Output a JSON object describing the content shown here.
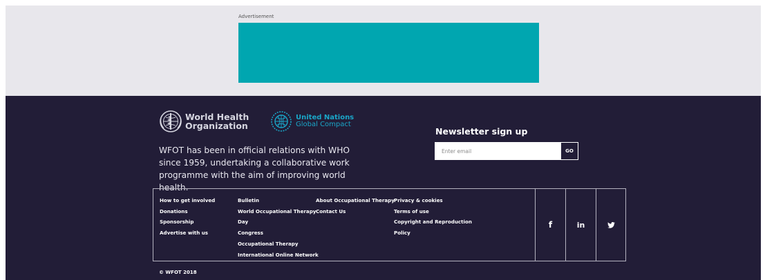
{
  "colors": {
    "ad_background": "#e8e7ec",
    "ad_banner": "#00a6b0",
    "footer_background": "#221d37",
    "un_accent": "#1aa6c8"
  },
  "ad": {
    "label": "Advertisement"
  },
  "logos": {
    "who": {
      "line1": "World Health",
      "line2": "Organization",
      "icon": "who-emblem-icon"
    },
    "un": {
      "line1": "United Nations",
      "line2": "Global Compact",
      "icon": "un-globe-icon"
    }
  },
  "about": {
    "text": "WFOT has been in official relations with WHO since 1959, undertaking a collaborative work programme with the aim of improving world health."
  },
  "newsletter": {
    "title": "Newsletter sign up",
    "email_placeholder": "Enter email",
    "email_value": "",
    "go_label": "GO"
  },
  "footer_links": {
    "col1": [
      "How to get involved",
      "Donations",
      "Sponsorship",
      "Advertise with us"
    ],
    "col2": [
      "Bulletin",
      "World Occupational Therapy",
      "Day",
      "Congress",
      "Occupational Therapy",
      "International Online Network"
    ],
    "col3": [
      "About Occupational Therapy",
      "Contact Us"
    ],
    "col4": [
      "Privacy & cookies",
      "Terms of use",
      "Copyright and Reproduction",
      "Policy"
    ]
  },
  "social": {
    "facebook": {
      "label": "f",
      "icon": "facebook-icon"
    },
    "linkedin": {
      "label": "in",
      "icon": "linkedin-icon"
    },
    "twitter": {
      "icon": "twitter-icon"
    }
  },
  "copyright": "© WFOT 2018"
}
